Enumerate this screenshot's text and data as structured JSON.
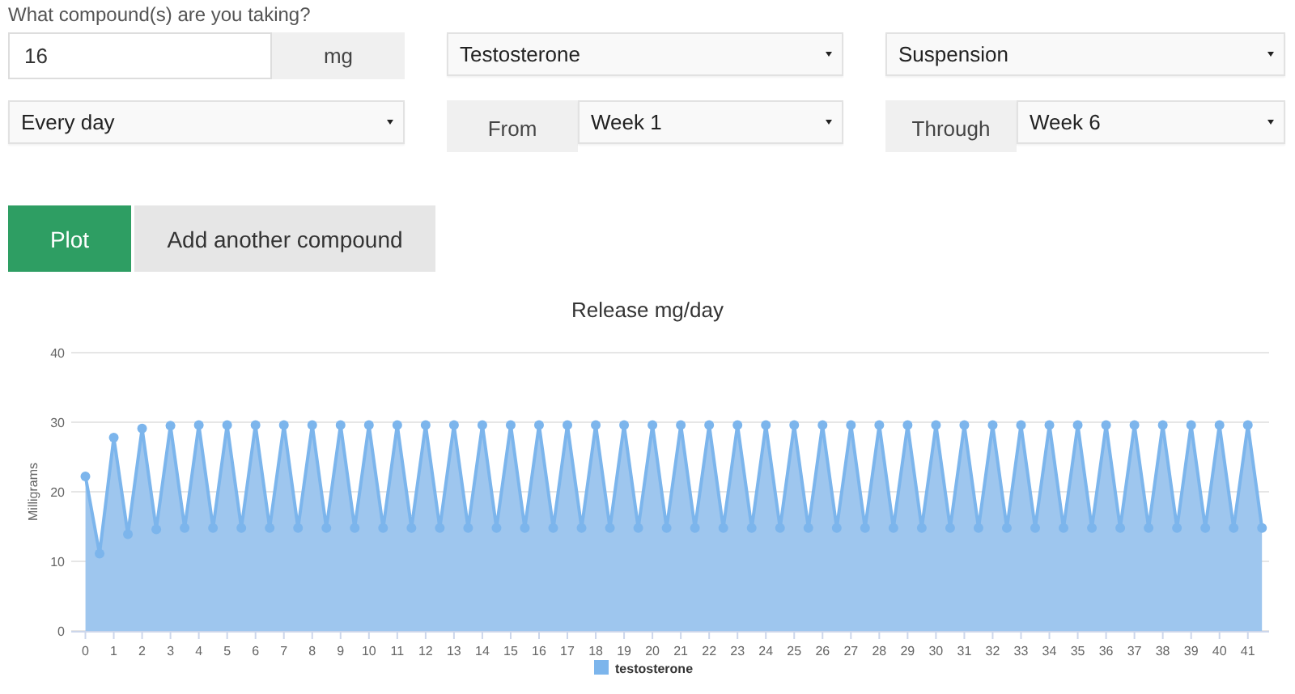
{
  "prompt": "What compound(s) are you taking?",
  "dose": {
    "value": "16",
    "unit": "mg"
  },
  "compound": {
    "value": "Testosterone"
  },
  "ester": {
    "value": "Suspension"
  },
  "frequency": {
    "value": "Every day"
  },
  "from": {
    "label": "From",
    "value": "Week 1"
  },
  "through": {
    "label": "Through",
    "value": "Week 6"
  },
  "buttons": [
    {
      "label": "Plot",
      "kind": "primary"
    },
    {
      "label": "Add another compound",
      "kind": "secondary"
    }
  ],
  "chart": {
    "chart_data": {
      "type": "area",
      "title": "Release mg/day",
      "ylabel": "Milligrams",
      "x": [
        0,
        0.5,
        1,
        1.5,
        2,
        2.5,
        3,
        3.5,
        4,
        4.5,
        5,
        5.5,
        6,
        6.5,
        7,
        7.5,
        8,
        8.5,
        9,
        9.5,
        10,
        10.5,
        11,
        11.5,
        12,
        12.5,
        13,
        13.5,
        14,
        14.5,
        15,
        15.5,
        16,
        16.5,
        17,
        17.5,
        18,
        18.5,
        19,
        19.5,
        20,
        20.5,
        21,
        21.5,
        22,
        22.5,
        23,
        23.5,
        24,
        24.5,
        25,
        25.5,
        26,
        26.5,
        27,
        27.5,
        28,
        28.5,
        29,
        29.5,
        30,
        30.5,
        31,
        31.5,
        32,
        32.5,
        33,
        33.5,
        34,
        34.5,
        35,
        35.5,
        36,
        36.5,
        37,
        37.5,
        38,
        38.5,
        39,
        39.5,
        40,
        40.5,
        41,
        41.5
      ],
      "series": [
        {
          "name": "testosterone",
          "color": "#7cb5ec",
          "values": [
            22.2,
            11.1,
            27.8,
            13.9,
            29.1,
            14.6,
            29.5,
            14.8,
            29.6,
            14.8,
            29.6,
            14.8,
            29.6,
            14.8,
            29.6,
            14.8,
            29.6,
            14.8,
            29.6,
            14.8,
            29.6,
            14.8,
            29.6,
            14.8,
            29.6,
            14.8,
            29.6,
            14.8,
            29.6,
            14.8,
            29.6,
            14.8,
            29.6,
            14.8,
            29.6,
            14.8,
            29.6,
            14.8,
            29.6,
            14.8,
            29.6,
            14.8,
            29.6,
            14.8,
            29.6,
            14.8,
            29.6,
            14.8,
            29.6,
            14.8,
            29.6,
            14.8,
            29.6,
            14.8,
            29.6,
            14.8,
            29.6,
            14.8,
            29.6,
            14.8,
            29.6,
            14.8,
            29.6,
            14.8,
            29.6,
            14.8,
            29.6,
            14.8,
            29.6,
            14.8,
            29.6,
            14.8,
            29.6,
            14.8,
            29.6,
            14.8,
            29.6,
            14.8,
            29.6,
            14.8,
            29.6,
            14.8,
            29.6,
            14.8
          ]
        }
      ],
      "xticks": [
        0,
        1,
        2,
        3,
        4,
        5,
        6,
        7,
        8,
        9,
        10,
        11,
        12,
        13,
        14,
        15,
        16,
        17,
        18,
        19,
        20,
        21,
        22,
        23,
        24,
        25,
        26,
        27,
        28,
        29,
        30,
        31,
        32,
        33,
        34,
        35,
        36,
        37,
        38,
        39,
        40,
        41
      ],
      "yticks": [
        0,
        10,
        20,
        30,
        40
      ],
      "xlim": [
        -0.5,
        41.75
      ],
      "ylim": [
        0,
        40
      ],
      "grid": true
    }
  }
}
